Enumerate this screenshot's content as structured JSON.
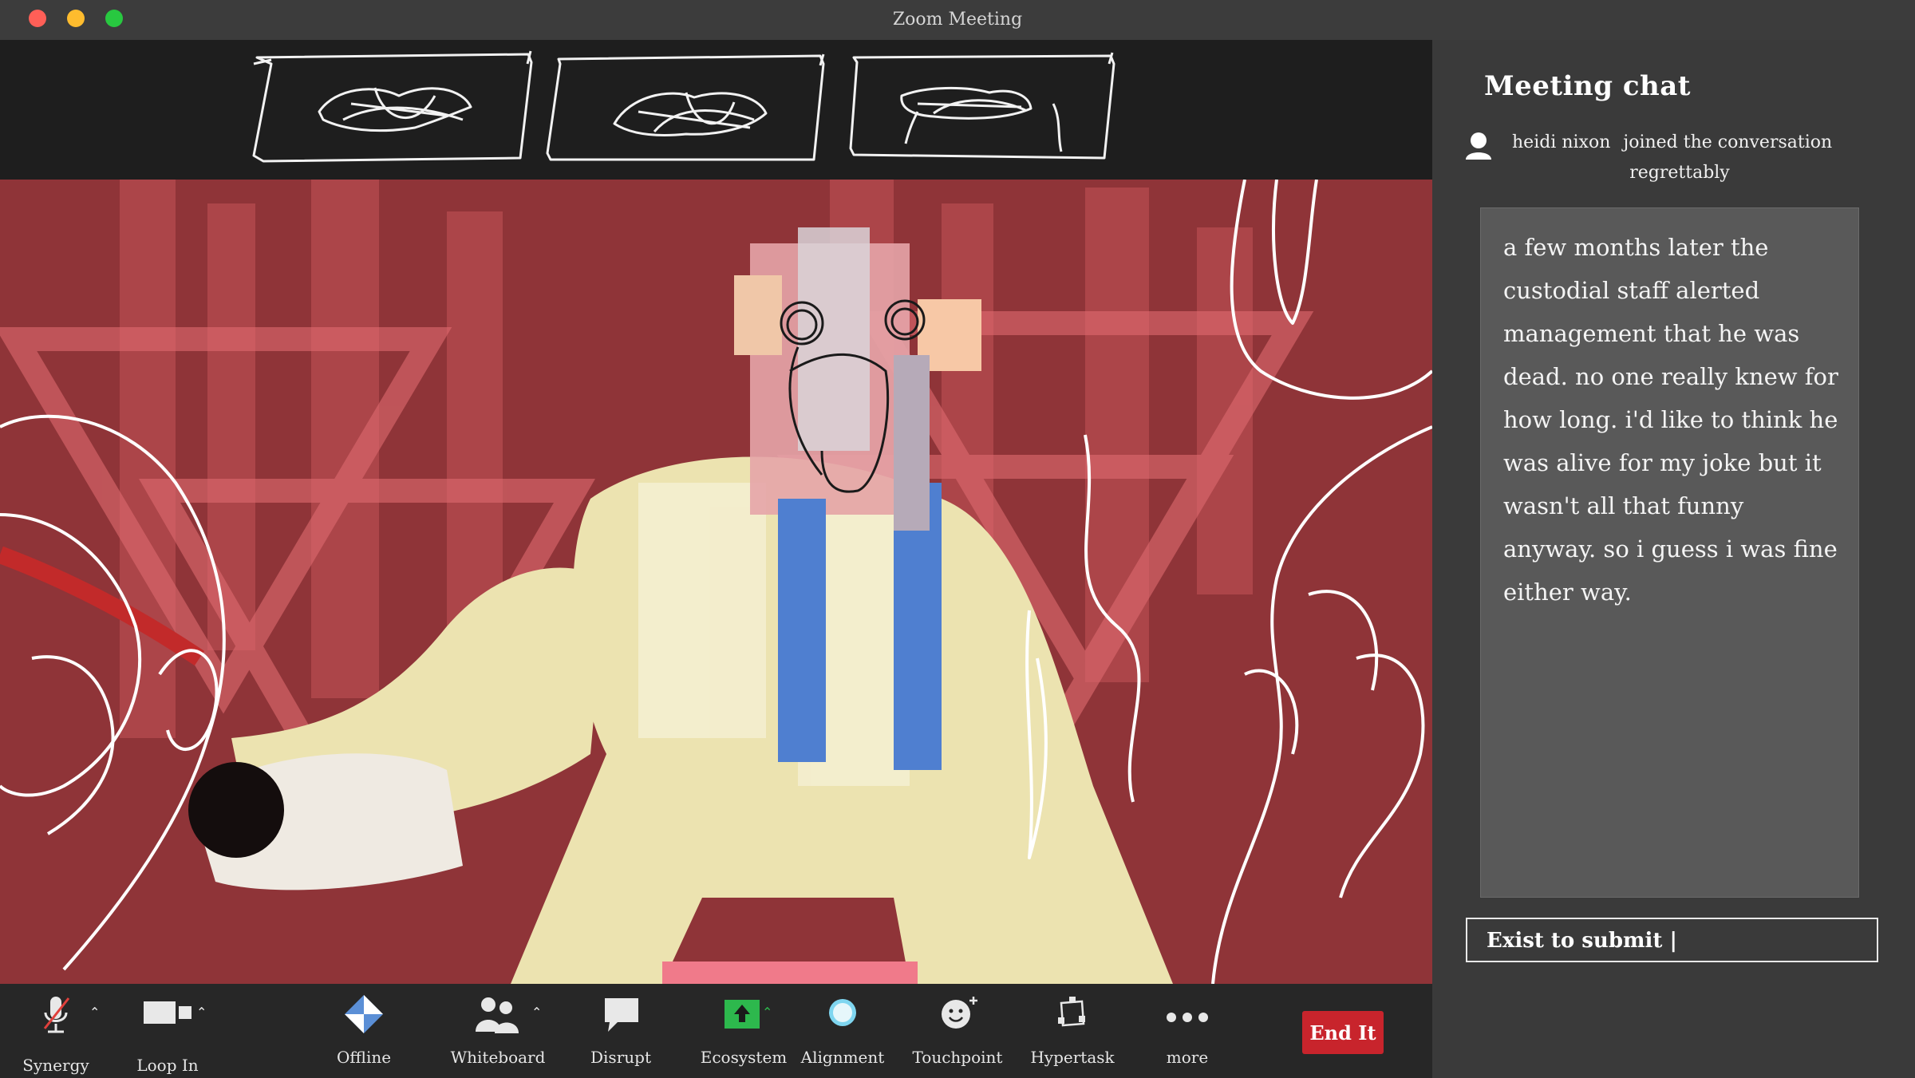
{
  "window": {
    "title": "Zoom Meeting"
  },
  "chat": {
    "title": "Meeting chat",
    "join_user": "heidi nixon",
    "join_action": "joined the conversation",
    "join_note": "regrettably",
    "message": "a few months later the custodial staff alerted management that he was dead. no one really knew for how long. i'd like to think he was alive for my joke but it wasn't all that funny anyway. so i guess i was fine either way.",
    "input_value": "Exist to submit |"
  },
  "toolbar": {
    "items": [
      {
        "label": "Synergy",
        "icon": "muted-microphone-icon"
      },
      {
        "label": "Loop In",
        "icon": "video-camera-icon"
      },
      {
        "label": "Offline",
        "icon": "diamond-logo-icon"
      },
      {
        "label": "Whiteboard",
        "icon": "participants-icon"
      },
      {
        "label": "Disrupt",
        "icon": "chat-bubble-icon"
      },
      {
        "label": "Ecosystem",
        "icon": "share-screen-icon"
      },
      {
        "label": "Alignment",
        "icon": "record-circle-icon"
      },
      {
        "label": "Touchpoint",
        "icon": "reaction-smiley-icon"
      },
      {
        "label": "Hypertask",
        "icon": "apps-icon"
      },
      {
        "label": "more",
        "icon": "more-dots-icon"
      }
    ],
    "end_label": "End It"
  },
  "colors": {
    "video_background": "#8f3438",
    "end_button": "#c8242c",
    "share_green": "#2db84d"
  }
}
